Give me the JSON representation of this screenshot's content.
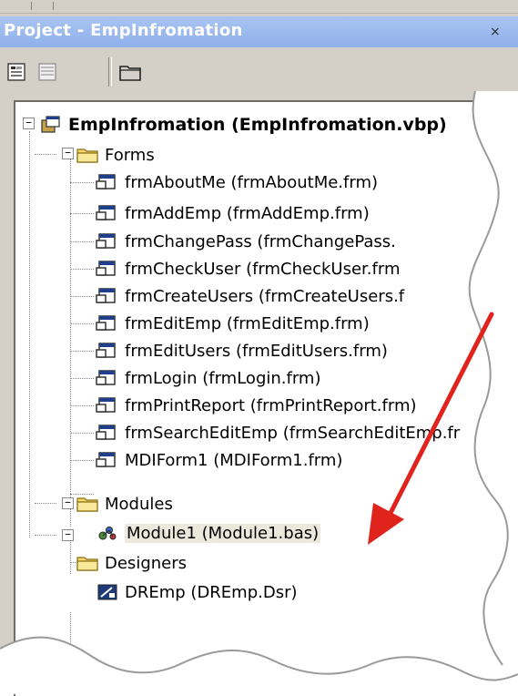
{
  "window": {
    "title": "Project - EmpInfromation"
  },
  "toolbar": {
    "buttons": [
      {
        "name": "view-code-icon"
      },
      {
        "name": "view-object-icon"
      },
      {
        "name": "toggle-folders-icon"
      }
    ]
  },
  "tree": {
    "project": "EmpInfromation (EmpInfromation.vbp)",
    "groups": {
      "forms": {
        "label": "Forms",
        "items": [
          "frmAboutMe (frmAboutMe.frm)",
          "frmAddEmp (frmAddEmp.frm)",
          "frmChangePass (frmChangePass.",
          "frmCheckUser (frmCheckUser.frm",
          "frmCreateUsers (frmCreateUsers.f",
          "frmEditEmp (frmEditEmp.frm)",
          "frmEditUsers (frmEditUsers.frm)",
          "frmLogin (frmLogin.frm)",
          "frmPrintReport (frmPrintReport.frm)",
          "frmSearchEditEmp (frmSearchEditEmp.fr",
          "MDIForm1 (MDIForm1.frm)"
        ]
      },
      "modules": {
        "label": "Modules",
        "items": [
          "Module1 (Module1.bas)"
        ]
      },
      "designers": {
        "label": "Designers",
        "items": [
          "DREmp (DREmp.Dsr)"
        ]
      }
    }
  },
  "colors": {
    "titlebar": "#a9c4f2",
    "panel": "#d4d0c8",
    "arrow": "#e0231c",
    "folder": "#f2d86a"
  }
}
